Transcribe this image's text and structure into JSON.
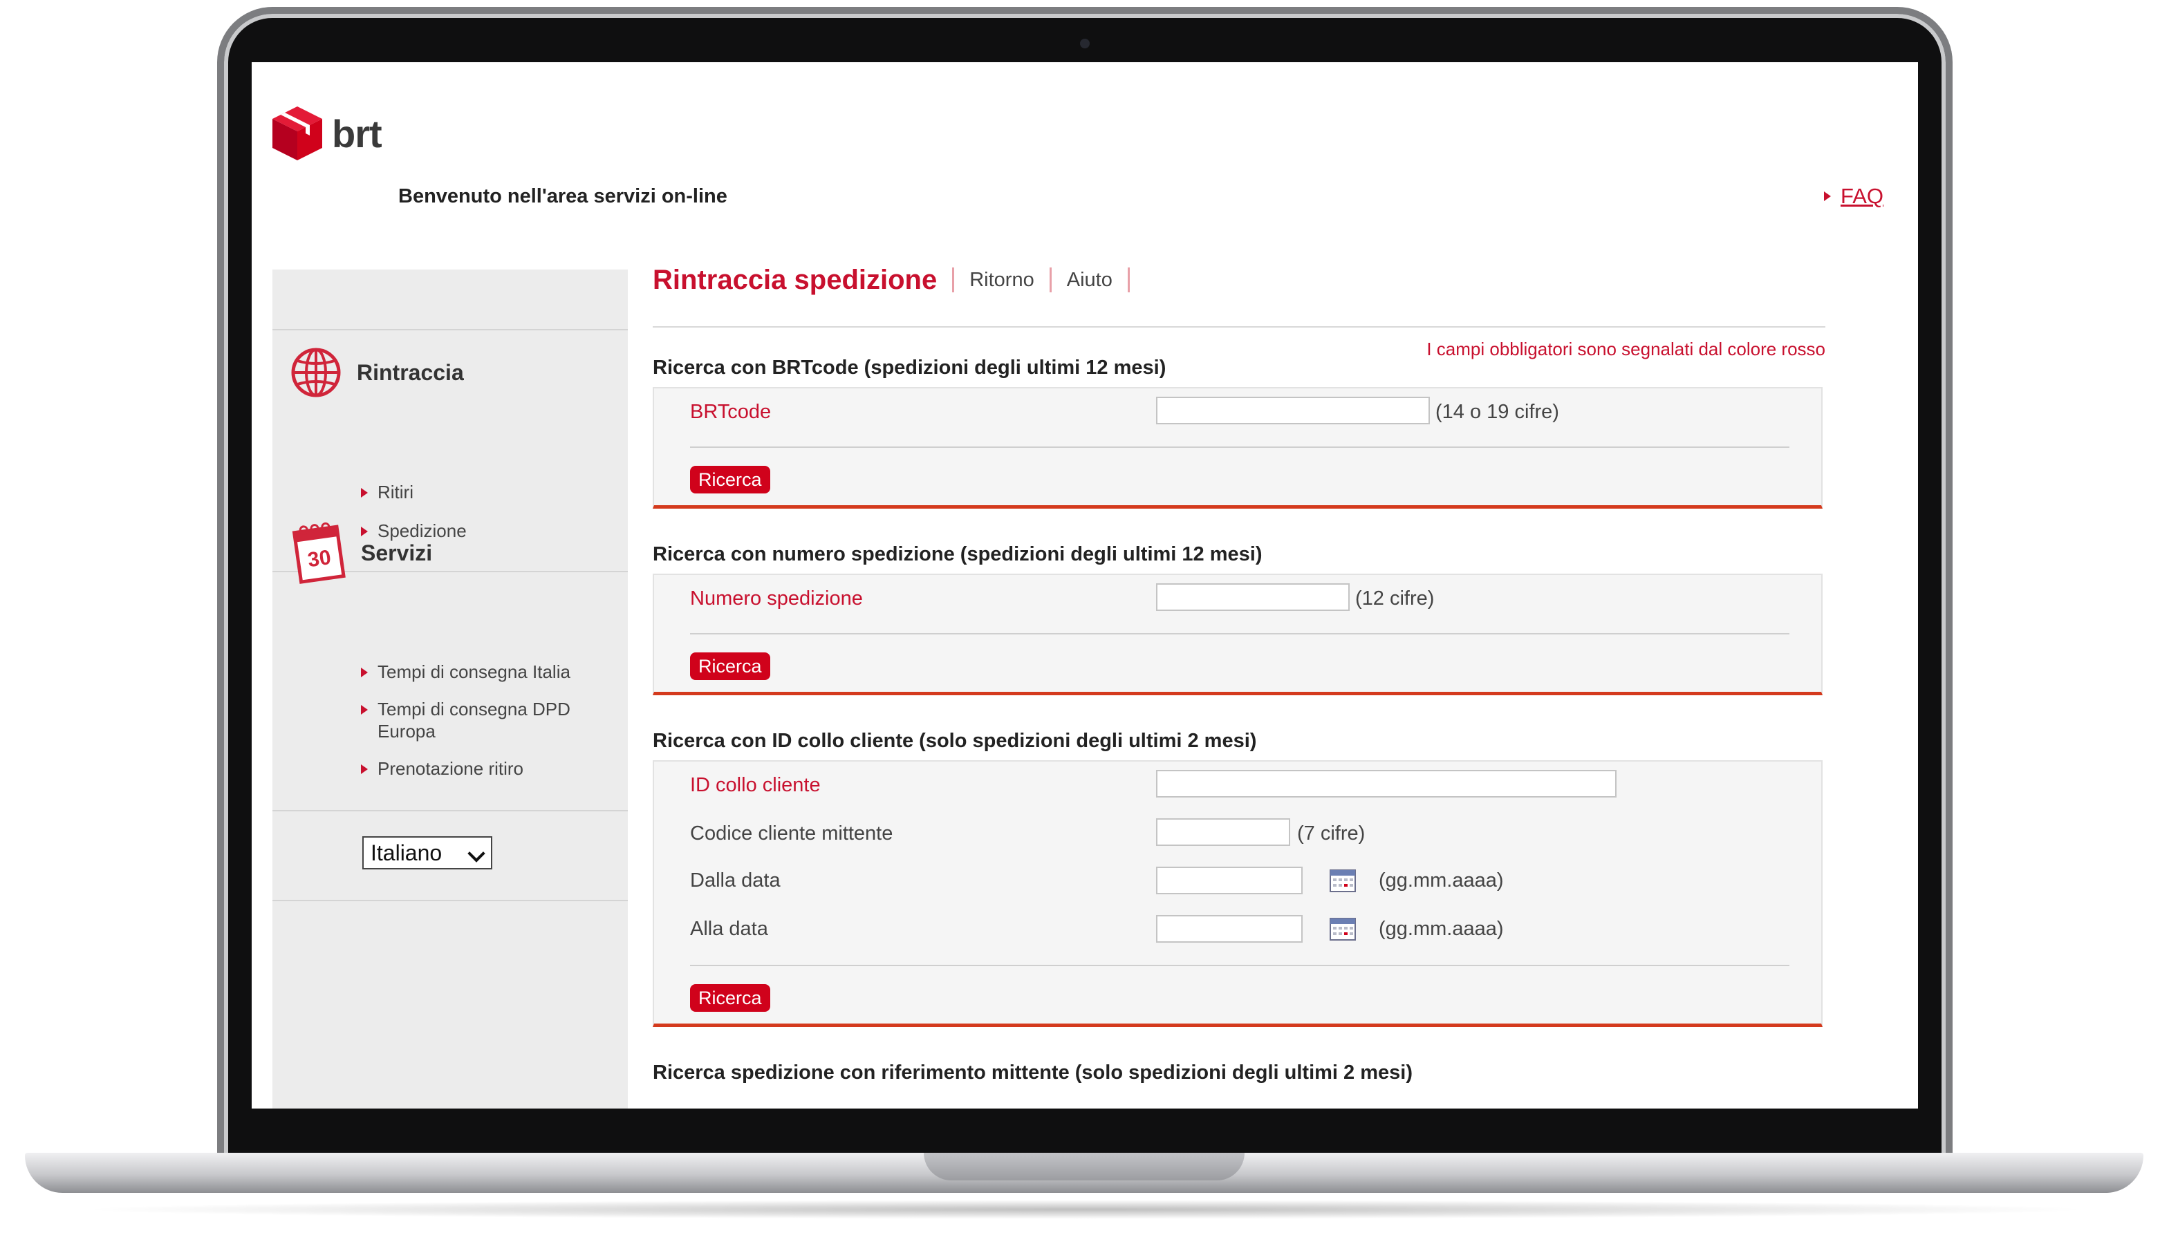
{
  "brand": {
    "logo_text": "brt",
    "accent": "#c8102e"
  },
  "header": {
    "welcome": "Benvenuto  nell'area servizi on-line",
    "faq": "FAQ"
  },
  "sidebar": {
    "sections": [
      {
        "title": "Rintraccia",
        "icon": "globe-icon",
        "links": [
          "Ritiri",
          "Spedizione"
        ]
      },
      {
        "title": "Servizi",
        "icon": "calendar-icon",
        "links": [
          "Tempi di consegna Italia",
          "Tempi di consegna DPD Europa",
          "Prenotazione ritiro"
        ]
      }
    ],
    "language": "Italiano"
  },
  "main": {
    "title": "Rintraccia spedizione",
    "tabs": [
      "Ritorno",
      "Aiuto"
    ],
    "mandatory_note": "I campi obbligatori sono segnalati dal colore rosso",
    "sections": [
      {
        "title": "Ricerca con BRTcode (spedizioni degli ultimi 12 mesi)",
        "fields": [
          {
            "label": "BRTcode",
            "hint": "(14 o 19 cifre)",
            "value": ""
          }
        ],
        "button": "Ricerca"
      },
      {
        "title": "Ricerca con numero spedizione (spedizioni degli ultimi 12 mesi)",
        "fields": [
          {
            "label": "Numero spedizione",
            "hint": "(12 cifre)",
            "value": ""
          }
        ],
        "button": "Ricerca"
      },
      {
        "title": "Ricerca con ID collo cliente (solo spedizioni degli ultimi 2 mesi)",
        "fields": [
          {
            "label": "ID collo cliente",
            "hint": "",
            "value": ""
          },
          {
            "label": "Codice cliente mittente",
            "hint": "(7 cifre)",
            "value": ""
          },
          {
            "label": "Dalla data",
            "hint": "(gg.mm.aaaa)",
            "value": ""
          },
          {
            "label": "Alla data",
            "hint": "(gg.mm.aaaa)",
            "value": ""
          }
        ],
        "button": "Ricerca"
      },
      {
        "title": "Ricerca spedizione con riferimento mittente (solo spedizioni degli ultimi 2 mesi)"
      }
    ]
  }
}
